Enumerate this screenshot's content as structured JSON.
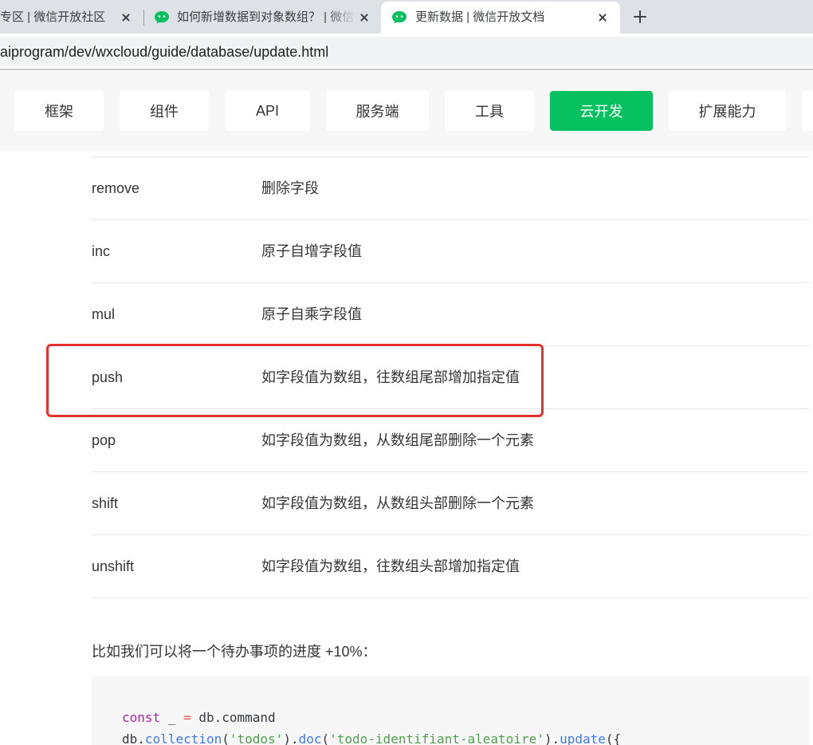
{
  "browser": {
    "tabs": [
      {
        "title": "专区 | 微信开放社区",
        "active": false
      },
      {
        "title": "如何新增数据到对象数组？ | 微信",
        "icon": "wechat-icon",
        "active": false
      },
      {
        "title": "更新数据 | 微信开放文档",
        "icon": "wechat-icon",
        "active": true
      }
    ],
    "close_icon": "close-icon",
    "new_tab_icon": "plus-icon",
    "url": "aiprogram/dev/wxcloud/guide/database/update.html"
  },
  "nav": {
    "items": [
      {
        "label": "框架",
        "active": false
      },
      {
        "label": "组件",
        "active": false
      },
      {
        "label": "API",
        "active": false
      },
      {
        "label": "服务端",
        "active": false
      },
      {
        "label": "工具",
        "active": false
      },
      {
        "label": "云开发",
        "active": true
      },
      {
        "label": "扩展能力",
        "active": false
      }
    ]
  },
  "update_operators": {
    "rows": [
      {
        "operator": "remove",
        "description": "删除字段",
        "highlighted": false
      },
      {
        "operator": "inc",
        "description": "原子自增字段值",
        "highlighted": false
      },
      {
        "operator": "mul",
        "description": "原子自乘字段值",
        "highlighted": false
      },
      {
        "operator": "push",
        "description": "如字段值为数组，往数组尾部增加指定值",
        "highlighted": true
      },
      {
        "operator": "pop",
        "description": "如字段值为数组，从数组尾部删除一个元素",
        "highlighted": false
      },
      {
        "operator": "shift",
        "description": "如字段值为数组，从数组头部删除一个元素",
        "highlighted": false
      },
      {
        "operator": "unshift",
        "description": "如字段值为数组，往数组头部增加指定值",
        "highlighted": false
      }
    ]
  },
  "example_text": "比如我们可以将一个待办事项的进度 +10%：",
  "code": {
    "colors": {
      "keyword": "#a626a4",
      "operator": "#e45649",
      "function": "#4078f2",
      "string": "#50a14f",
      "plain": "#383a42"
    },
    "lines": [
      [
        {
          "text": "const",
          "type": "keyword"
        },
        {
          "text": " _ ",
          "type": "plain"
        },
        {
          "text": "=",
          "type": "operator"
        },
        {
          "text": " db.command",
          "type": "plain"
        }
      ],
      [
        {
          "text": "db.",
          "type": "plain"
        },
        {
          "text": "collection",
          "type": "function"
        },
        {
          "text": "(",
          "type": "plain"
        },
        {
          "text": "'todos'",
          "type": "string"
        },
        {
          "text": ").",
          "type": "plain"
        },
        {
          "text": "doc",
          "type": "function"
        },
        {
          "text": "(",
          "type": "plain"
        },
        {
          "text": "'todo-identifiant-aleatoire'",
          "type": "string"
        },
        {
          "text": ").",
          "type": "plain"
        },
        {
          "text": "update",
          "type": "function"
        },
        {
          "text": "({",
          "type": "plain"
        }
      ]
    ]
  },
  "colors": {
    "accent": "#07c160",
    "annotation": "#e5322d",
    "wechat_green": "#07c160"
  }
}
